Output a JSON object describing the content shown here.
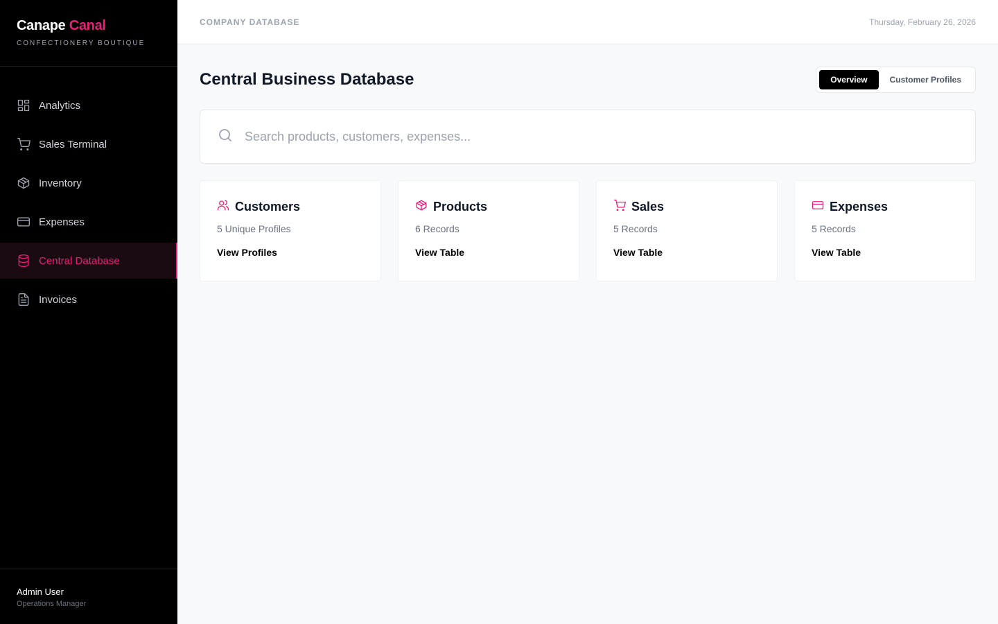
{
  "brand": {
    "name_part1": "Canape",
    "name_part2": "Canal",
    "subtitle": "CONFECTIONERY BOUTIQUE"
  },
  "sidebar": {
    "items": [
      {
        "label": "Analytics",
        "icon": "grid-icon"
      },
      {
        "label": "Sales Terminal",
        "icon": "cart-icon"
      },
      {
        "label": "Inventory",
        "icon": "box-icon"
      },
      {
        "label": "Expenses",
        "icon": "card-icon"
      },
      {
        "label": "Central Database",
        "icon": "database-icon",
        "active": true
      },
      {
        "label": "Invoices",
        "icon": "document-icon"
      }
    ]
  },
  "user": {
    "name": "Admin User",
    "role": "Operations Manager"
  },
  "header": {
    "breadcrumb": "COMPANY DATABASE",
    "date": "Thursday, February 26, 2026"
  },
  "page": {
    "title": "Central Business Database",
    "tabs": [
      {
        "label": "Overview",
        "active": true
      },
      {
        "label": "Customer Profiles"
      }
    ]
  },
  "search": {
    "placeholder": "Search products, customers, expenses...",
    "value": ""
  },
  "cards": [
    {
      "title": "Customers",
      "count": "5 Unique Profiles",
      "link": "View Profiles",
      "icon": "users-icon"
    },
    {
      "title": "Products",
      "count": "6 Records",
      "link": "View Table",
      "icon": "box-icon"
    },
    {
      "title": "Sales",
      "count": "5 Records",
      "link": "View Table",
      "icon": "cart-icon"
    },
    {
      "title": "Expenses",
      "count": "5 Records",
      "link": "View Table",
      "icon": "card-icon"
    }
  ],
  "colors": {
    "accent": "#ec1e79",
    "sidebar_bg": "#000000",
    "page_bg": "#f8f9fb"
  }
}
